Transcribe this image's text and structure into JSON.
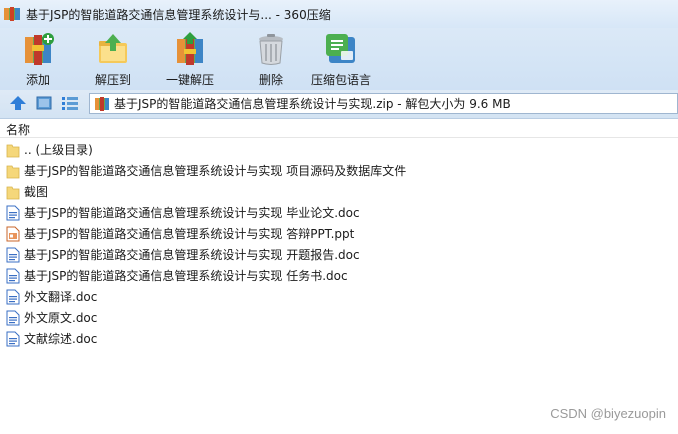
{
  "window": {
    "title": "基于JSP的智能道路交通信息管理系统设计与... - 360压缩"
  },
  "toolbar": {
    "buttons": [
      {
        "label": "添加",
        "icon": "add-archive-icon"
      },
      {
        "label": "解压到",
        "icon": "extract-to-icon"
      },
      {
        "label": "一键解压",
        "icon": "one-click-extract-icon"
      },
      {
        "label": "删除",
        "icon": "trash-icon"
      },
      {
        "label": "压缩包语言",
        "icon": "archive-language-icon"
      }
    ]
  },
  "navbar": {
    "path": "基于JSP的智能道路交通信息管理系统设计与实现.zip - 解包大小为 9.6 MB"
  },
  "list": {
    "column_name": "名称",
    "items": [
      {
        "label": ".. (上级目录)",
        "type": "folder"
      },
      {
        "label": "基于JSP的智能道路交通信息管理系统设计与实现 项目源码及数据库文件",
        "type": "folder"
      },
      {
        "label": "截图",
        "type": "folder"
      },
      {
        "label": "基于JSP的智能道路交通信息管理系统设计与实现 毕业论文.doc",
        "type": "doc"
      },
      {
        "label": "基于JSP的智能道路交通信息管理系统设计与实现 答辩PPT.ppt",
        "type": "ppt"
      },
      {
        "label": "基于JSP的智能道路交通信息管理系统设计与实现 开题报告.doc",
        "type": "doc"
      },
      {
        "label": "基于JSP的智能道路交通信息管理系统设计与实现 任务书.doc",
        "type": "doc"
      },
      {
        "label": "外文翻译.doc",
        "type": "doc"
      },
      {
        "label": "外文原文.doc",
        "type": "doc"
      },
      {
        "label": "文献综述.doc",
        "type": "doc"
      }
    ]
  },
  "watermark": "CSDN @biyezuopin",
  "colors": {
    "folder": "#f5d77a",
    "doc_blue": "#3a6fc4",
    "toolbar_bg": "#d5e5f6"
  }
}
